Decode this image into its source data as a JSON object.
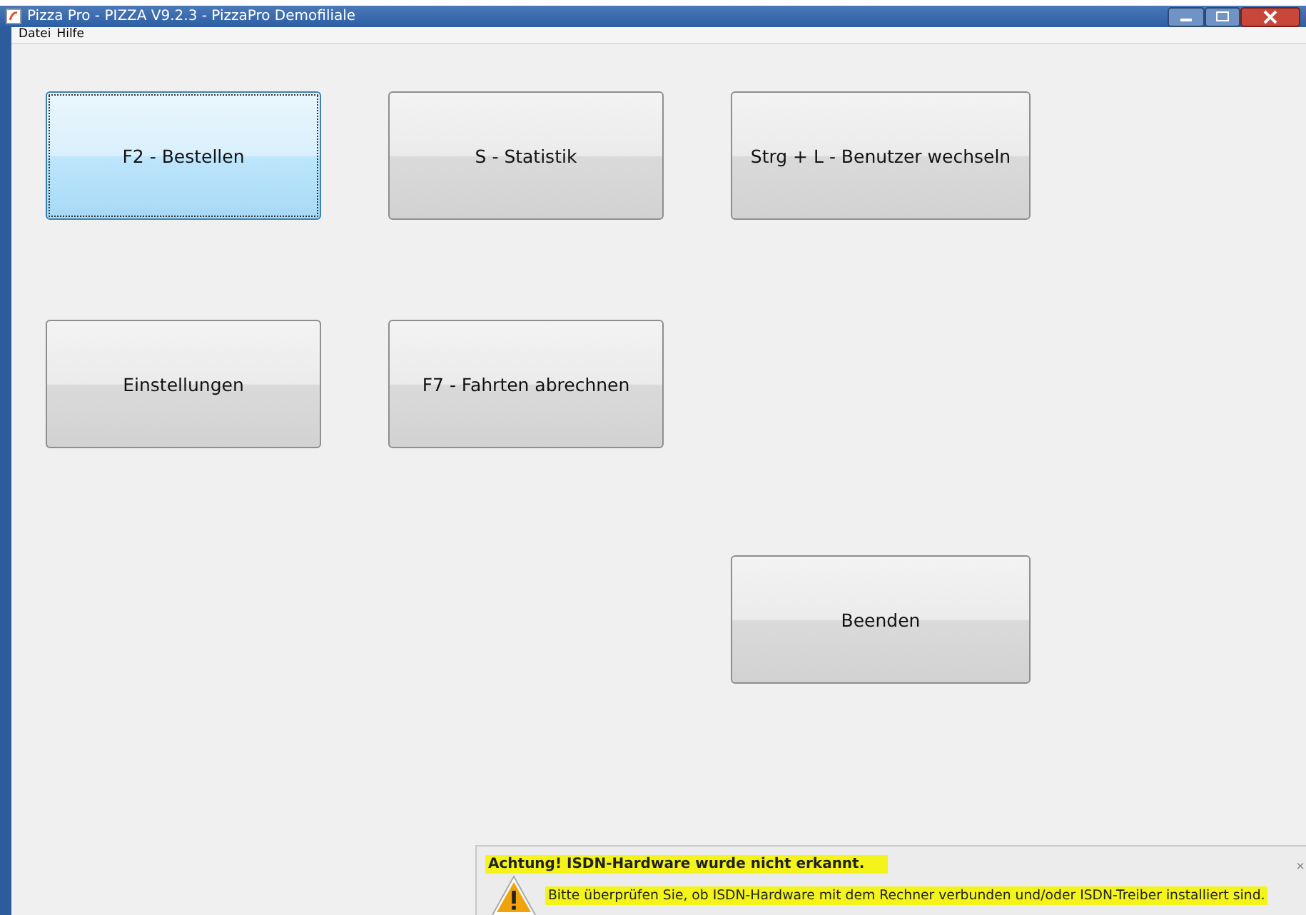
{
  "window": {
    "title": "Pizza Pro - PIZZA V9.2.3 - PizzaPro Demofiliale"
  },
  "menu": [
    "Datei",
    "Hilfe"
  ],
  "buttons": [
    {
      "label": "F2 - Bestellen",
      "selected": true
    },
    {
      "label": "S - Statistik",
      "selected": false
    },
    {
      "label": "Strg + L - Benutzer wechseln",
      "selected": false
    },
    {
      "label": "Einstellungen",
      "selected": false
    },
    {
      "label": "F7 - Fahrten abrechnen",
      "selected": false
    },
    {
      "label": "Beenden",
      "selected": false
    }
  ],
  "notification": {
    "title": "Achtung! ISDN-Hardware wurde nicht erkannt.",
    "message": "Bitte überprüfen Sie, ob ISDN-Hardware mit dem Rechner verbunden und/oder ISDN-Treiber installiert sind.",
    "close": "×",
    "highlighted": true
  }
}
